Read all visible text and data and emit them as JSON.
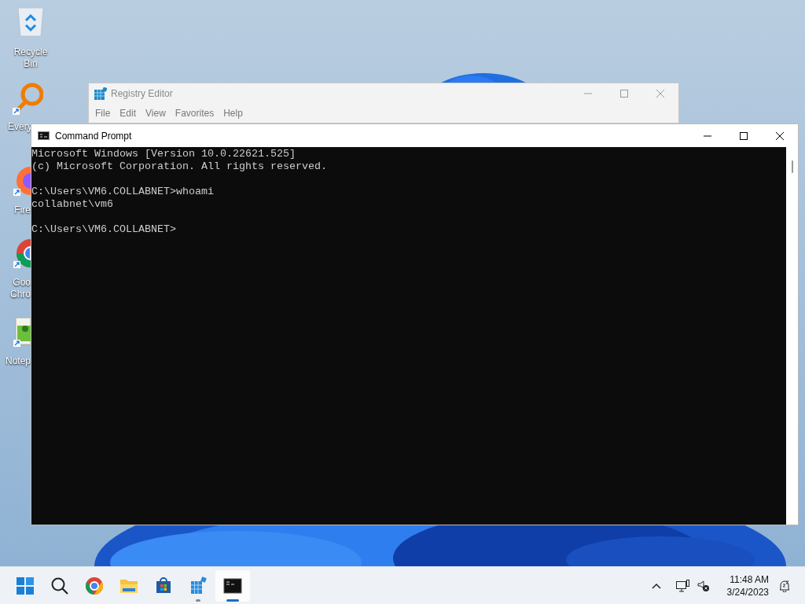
{
  "desktop_icons": [
    {
      "kind": "recycle",
      "lines": [
        "Recycle Bin"
      ]
    },
    {
      "kind": "search",
      "lines": [
        "Every"
      ]
    },
    {
      "kind": "firefox",
      "lines": [
        "Fire"
      ]
    },
    {
      "kind": "chrome",
      "lines": [
        "Goo",
        "Chro"
      ]
    },
    {
      "kind": "notepad",
      "lines": [
        "Notep"
      ]
    }
  ],
  "registry_editor": {
    "title": "Registry Editor",
    "menu": [
      "File",
      "Edit",
      "View",
      "Favorites",
      "Help"
    ]
  },
  "command_prompt": {
    "title": "Command Prompt",
    "blocks": [
      [
        "Microsoft Windows [Version 10.0.22621.525]",
        "(c) Microsoft Corporation. All rights reserved."
      ],
      [
        "C:\\Users\\VM6.COLLABNET>whoami",
        "collabnet\\vm6"
      ],
      [
        "C:\\Users\\VM6.COLLABNET>"
      ]
    ]
  },
  "taskbar": {
    "apps": [
      {
        "kind": "start",
        "running": false,
        "selected": false
      },
      {
        "kind": "search",
        "running": false,
        "selected": false
      },
      {
        "kind": "chrome",
        "running": false,
        "selected": false
      },
      {
        "kind": "folder",
        "running": false,
        "selected": false
      },
      {
        "kind": "store",
        "running": false,
        "selected": false
      },
      {
        "kind": "registry",
        "running": true,
        "selected": false
      },
      {
        "kind": "terminal",
        "running": true,
        "selected": true
      }
    ],
    "clock": {
      "time": "11:48 AM",
      "date": "3/24/2023"
    }
  }
}
